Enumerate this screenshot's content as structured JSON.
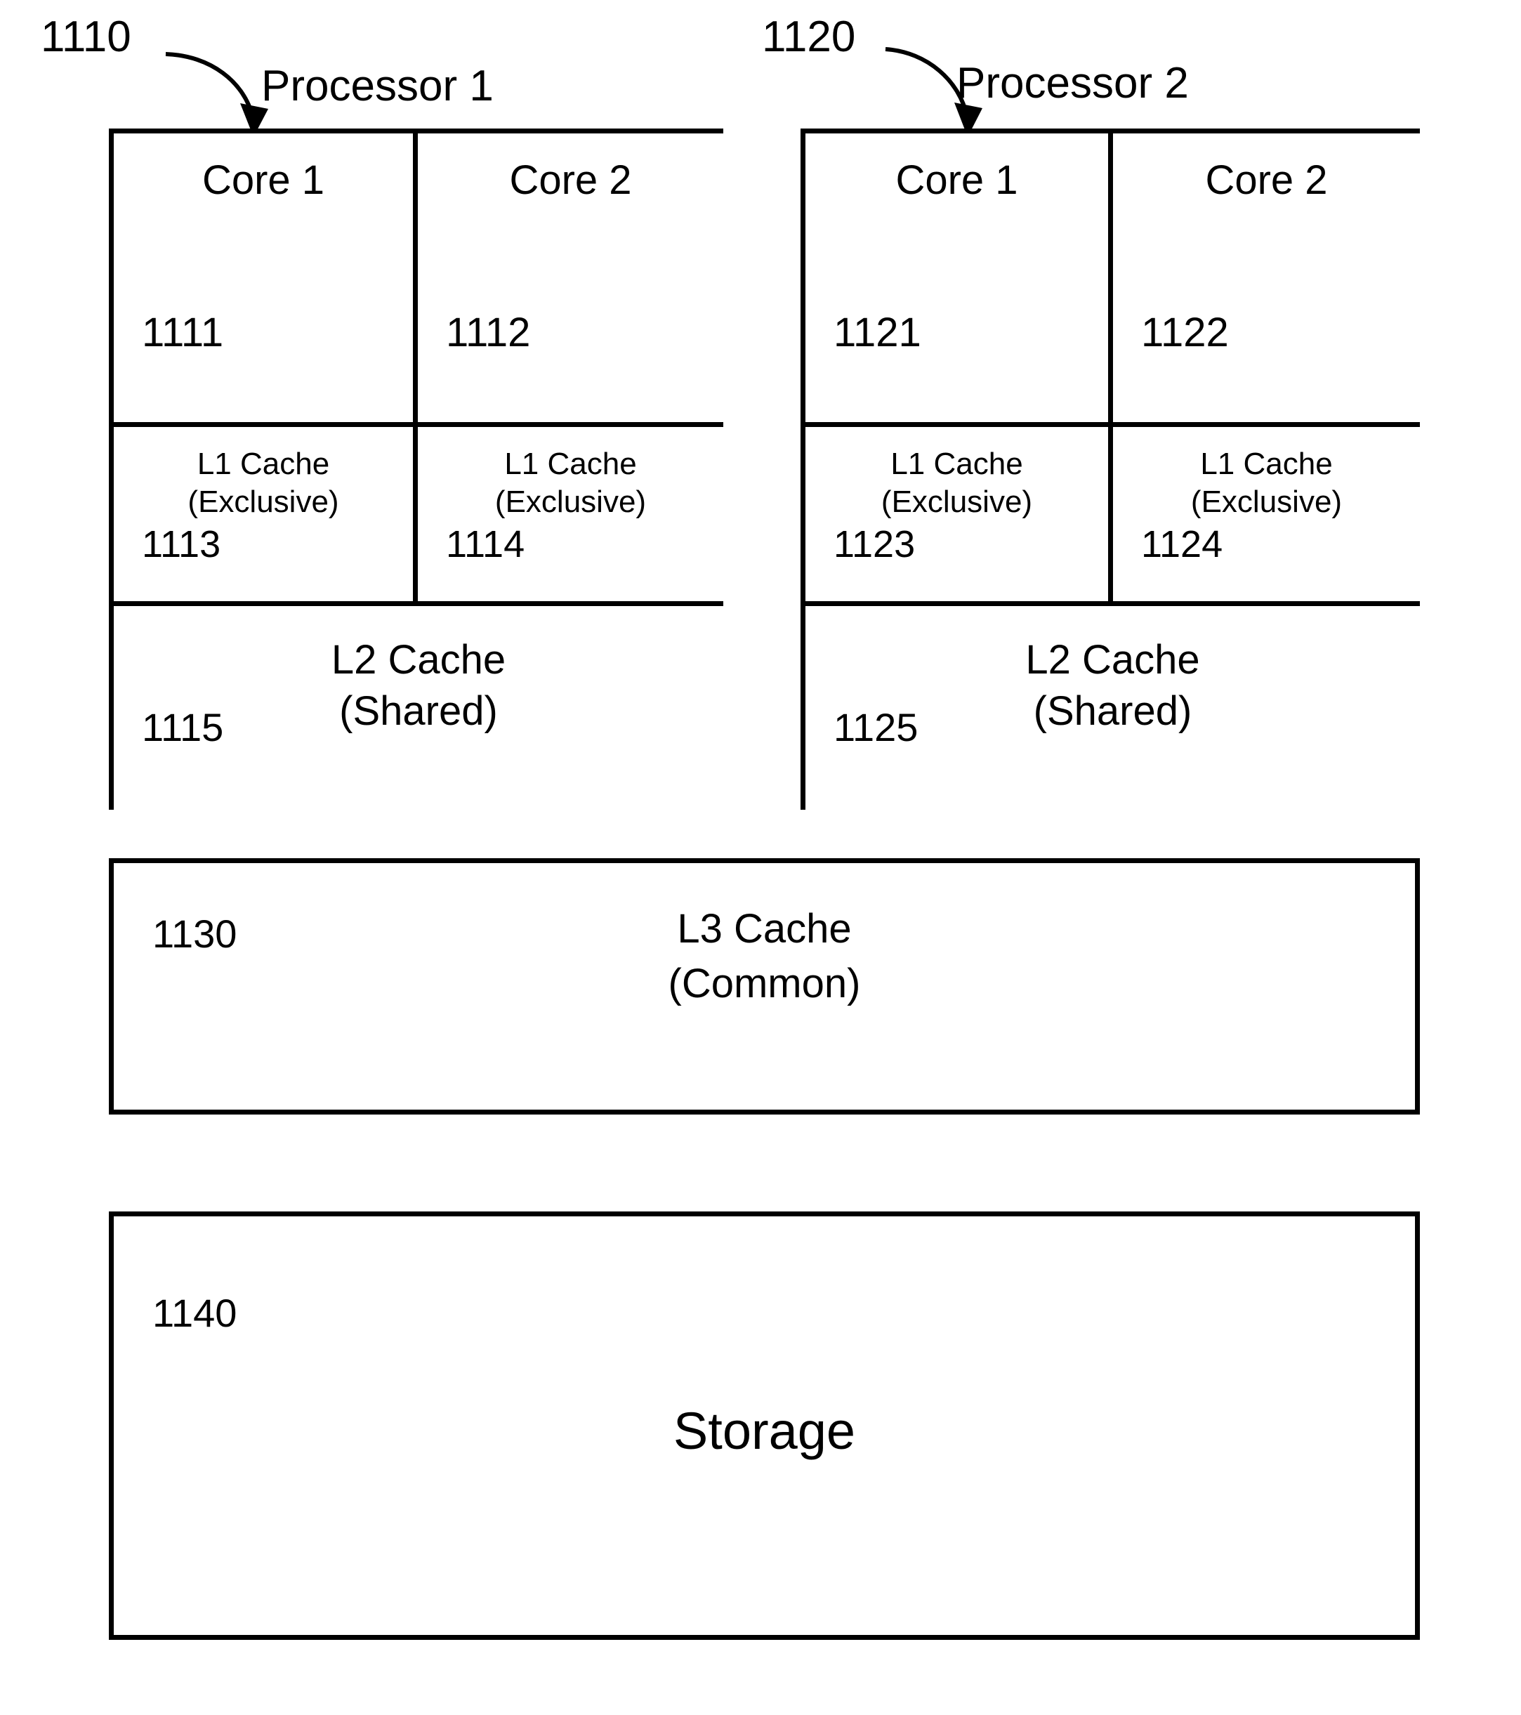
{
  "figure": {
    "processors": [
      {
        "ref": "1110",
        "title": "Processor 1",
        "cores": [
          {
            "label": "Core 1",
            "ref": "1111"
          },
          {
            "label": "Core 2",
            "ref": "1112"
          }
        ],
        "l1_caches": [
          {
            "line1": "L1 Cache",
            "line2": "(Exclusive)",
            "ref": "1113"
          },
          {
            "line1": "L1 Cache",
            "line2": "(Exclusive)",
            "ref": "1114"
          }
        ],
        "l2_cache": {
          "line1": "L2 Cache",
          "line2": "(Shared)",
          "ref": "1115"
        }
      },
      {
        "ref": "1120",
        "title": "Processor 2",
        "cores": [
          {
            "label": "Core 1",
            "ref": "1121"
          },
          {
            "label": "Core 2",
            "ref": "1122"
          }
        ],
        "l1_caches": [
          {
            "line1": "L1 Cache",
            "line2": "(Exclusive)",
            "ref": "1123"
          },
          {
            "line1": "L1 Cache",
            "line2": "(Exclusive)",
            "ref": "1124"
          }
        ],
        "l2_cache": {
          "line1": "L2 Cache",
          "line2": "(Shared)",
          "ref": "1125"
        }
      }
    ],
    "l3_cache": {
      "ref": "1130",
      "line1": "L3 Cache",
      "line2": "(Common)"
    },
    "storage": {
      "ref": "1140",
      "label": "Storage"
    },
    "colors": {
      "stroke": "#000000",
      "background": "#ffffff"
    }
  }
}
